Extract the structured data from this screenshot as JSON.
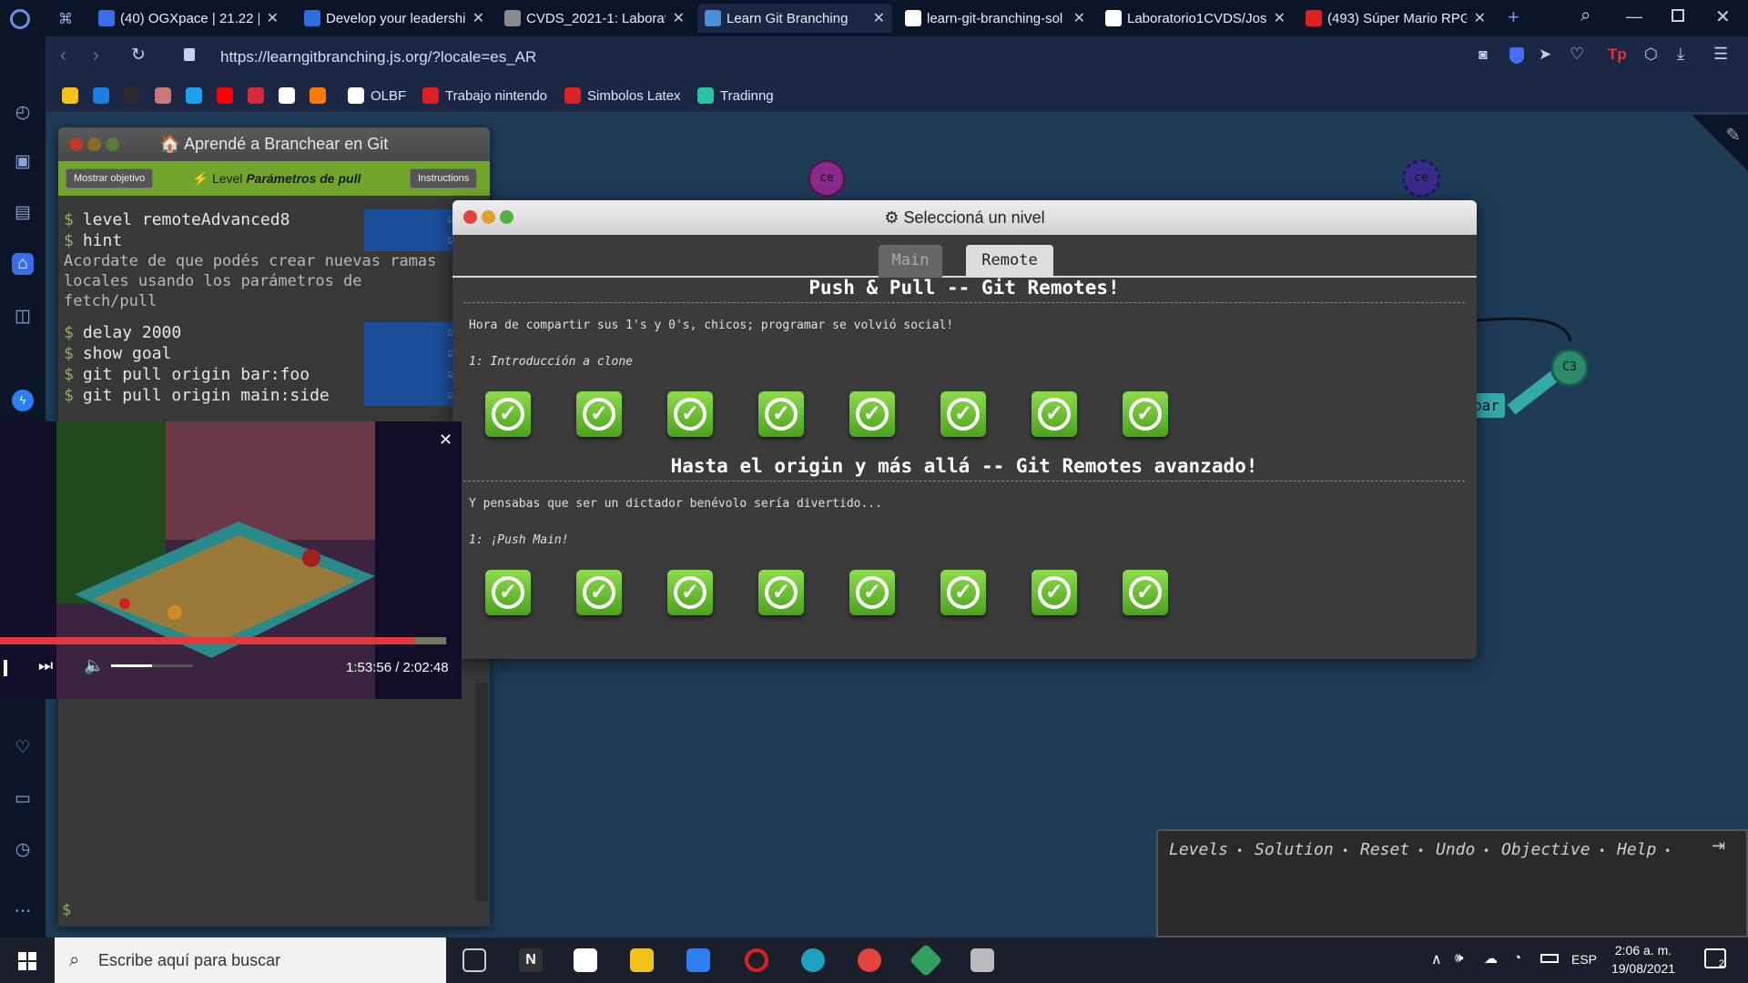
{
  "browser": {
    "tabs": [
      {
        "title": "(40) OGXpace | 21.22 |",
        "active": false,
        "color": "#3a6ee8"
      },
      {
        "title": "Develop your leadershi",
        "active": false,
        "color": "#2b6fe0"
      },
      {
        "title": "CVDS_2021-1: Laborato",
        "active": false,
        "color": "#8a8a8a"
      },
      {
        "title": "Learn Git Branching",
        "active": true,
        "color": "#4a8fd8"
      },
      {
        "title": "learn-git-branching-sol",
        "active": false,
        "color": "#ffffff"
      },
      {
        "title": "Laboratorio1CVDS/Jose",
        "active": false,
        "color": "#ffffff"
      },
      {
        "title": "(493) Súper Mario RPG",
        "active": false,
        "color": "#e02020"
      }
    ],
    "close_glyph": "✕",
    "new_tab_glyph": "+",
    "url": "https://learngitbranching.js.org/?locale=es_AR",
    "bookmarks": [
      {
        "label": "",
        "color": "#f2c218"
      },
      {
        "label": "",
        "color": "#1e7de0"
      },
      {
        "label": "",
        "color": "#2b2b2b"
      },
      {
        "label": "",
        "color": "#c77"
      },
      {
        "label": "",
        "color": "#1da1f2"
      },
      {
        "label": "",
        "color": "#ff0000"
      },
      {
        "label": "",
        "color": "#d9283a"
      },
      {
        "label": "",
        "color": "#ffffff"
      },
      {
        "label": "",
        "color": "#ff7a00"
      },
      {
        "label": "OLBF",
        "color": "#ffffff"
      },
      {
        "label": "Trabajo nintendo",
        "color": "#e02020"
      },
      {
        "label": "Simbolos Latex",
        "color": "#e02020"
      },
      {
        "label": "Tradinng",
        "color": "#27c4a0"
      }
    ]
  },
  "terminal": {
    "title": "🏠 Aprendé a Branchear en Git",
    "goal_button": "Mostrar objetivo",
    "level_label": "⚡ Level ",
    "level_name": "Parámetros de pull",
    "instructions_button": "Instructions",
    "commands_top": [
      "level remoteAdvanced8",
      "hint"
    ],
    "hint_text": "Acordate de que podés crear nuevas ramas\nlocales usando los parámetros de\nfetch/pull",
    "commands_bottom": [
      "delay 2000",
      "show goal",
      "git pull origin bar:foo",
      "git pull origin main:side"
    ],
    "prompt": "$"
  },
  "graph": {
    "nodes": [
      {
        "label": "ce",
        "color": "#8a2a8a"
      },
      {
        "label": "ce",
        "color": "#3a2a8a"
      },
      {
        "label": "C3",
        "color": "#2a8a6a"
      }
    ],
    "branch_label": "bar"
  },
  "level_dialog": {
    "title": "⚙ Seleccioná un nivel",
    "tabs": [
      "Main",
      "Remote"
    ],
    "active_tab": "Remote",
    "sections": [
      {
        "heading": "Push & Pull -- Git Remotes!",
        "about": "Hora de compartir sus 1's y 0's, chicos; programar se volvió social!",
        "level_name": "1: Introducción a clone",
        "levels_completed": 8
      },
      {
        "heading": "Hasta el origin y más allá -- Git Remotes avanzado!",
        "about": "Y pensabas que ser un dictador benévolo sería divertido...",
        "level_name": "1: ¡Push Main!",
        "levels_completed": 8
      }
    ]
  },
  "video": {
    "time": "1:53:56 / 2:02:48",
    "progress": 0.93,
    "volume": 0.5,
    "close": "✕"
  },
  "command_bar": {
    "items": [
      "Levels",
      "•",
      "Solution",
      "•",
      "Reset",
      "•",
      "Undo",
      "•",
      "Objective",
      "•",
      "Help",
      "•"
    ]
  },
  "taskbar": {
    "search_placeholder": "Escribe aquí para buscar",
    "language": "ESP",
    "time": "2:06 a. m.",
    "date": "19/08/2021",
    "notifications": "2"
  }
}
